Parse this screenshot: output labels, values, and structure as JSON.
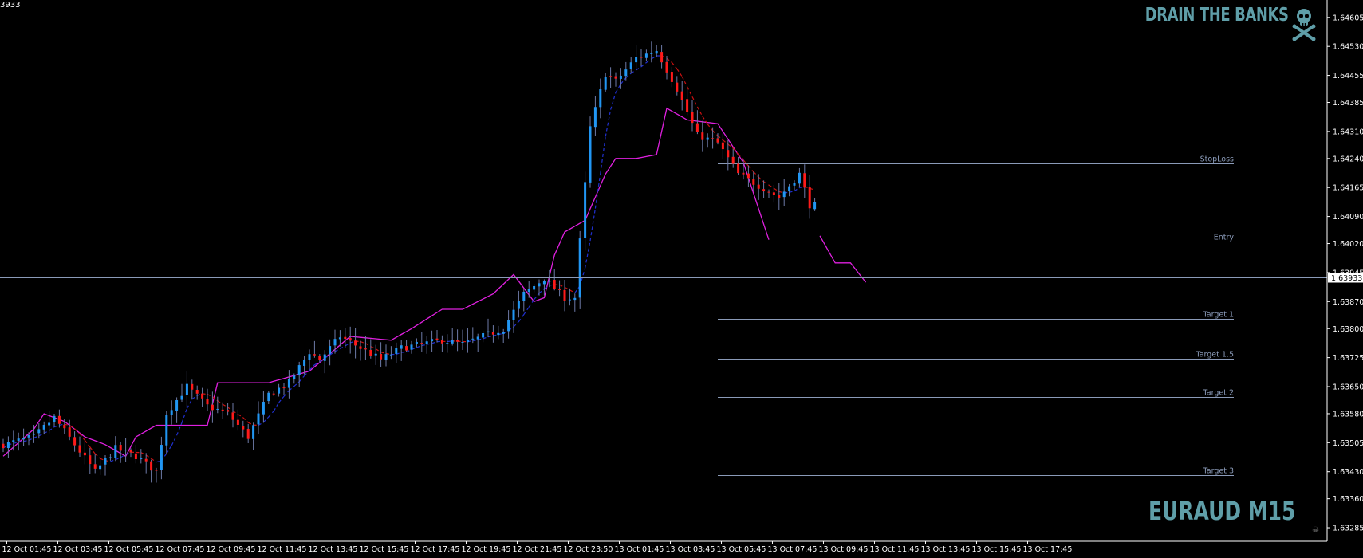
{
  "header": {
    "brand": "DRAIN THE BANKS",
    "counter": "3933",
    "mini_icon": "skull-icon"
  },
  "footer": {
    "symbol": "EURAUD M15"
  },
  "colors": {
    "background": "#000000",
    "bull": "#2196f3",
    "bear": "#ff1a1a",
    "wick": "#6e7aa8",
    "envelope": "#e020e0",
    "ma_fast": "#2030d0",
    "ma_slow": "#cc1010",
    "levels": "#8a9ab8",
    "brand": "#5f9ea8",
    "axis": "#ffffff"
  },
  "chart_data": {
    "type": "candlestick",
    "price_axis": {
      "ticks": [
        "1.64605",
        "1.64530",
        "1.64455",
        "1.64385",
        "1.64310",
        "1.64240",
        "1.64165",
        "1.64090",
        "1.64020",
        "1.63945",
        "1.63870",
        "1.63800",
        "1.63725",
        "1.63650",
        "1.63580",
        "1.63505",
        "1.63430",
        "1.63360",
        "1.63285"
      ],
      "ylim": [
        1.6325,
        1.6465
      ]
    },
    "time_axis": {
      "labels": [
        "12 Oct 01:45",
        "12 Oct 03:45",
        "12 Oct 05:45",
        "12 Oct 07:45",
        "12 Oct 09:45",
        "12 Oct 11:45",
        "12 Oct 13:45",
        "12 Oct 15:45",
        "12 Oct 17:45",
        "12 Oct 19:45",
        "12 Oct 21:45",
        "12 Oct 23:50",
        "13 Oct 01:45",
        "13 Oct 03:45",
        "13 Oct 05:45",
        "13 Oct 07:45",
        "13 Oct 09:45",
        "13 Oct 11:45",
        "13 Oct 13:45",
        "13 Oct 15:45",
        "13 Oct 17:45"
      ]
    },
    "current_price": "1.63933",
    "levels": [
      {
        "name": "StopLoss",
        "price": 1.64227
      },
      {
        "name": "Entry",
        "price": 1.64026
      },
      {
        "name": "Target 1",
        "price": 1.63825
      },
      {
        "name": "Target 1.5",
        "price": 1.63723
      },
      {
        "name": "Target 2",
        "price": 1.63624
      },
      {
        "name": "Target 3",
        "price": 1.63422
      }
    ],
    "candle_count": 160,
    "anchors": [
      [
        0,
        1.635
      ],
      [
        6,
        1.6352
      ],
      [
        10,
        1.6357
      ],
      [
        14,
        1.635
      ],
      [
        18,
        1.6343
      ],
      [
        22,
        1.6349
      ],
      [
        26,
        1.6347
      ],
      [
        30,
        1.6343
      ],
      [
        32,
        1.6358
      ],
      [
        36,
        1.6365
      ],
      [
        40,
        1.636
      ],
      [
        44,
        1.6358
      ],
      [
        48,
        1.6352
      ],
      [
        52,
        1.6363
      ],
      [
        56,
        1.6366
      ],
      [
        60,
        1.6374
      ],
      [
        62,
        1.6372
      ],
      [
        66,
        1.6378
      ],
      [
        70,
        1.6375
      ],
      [
        74,
        1.6372
      ],
      [
        78,
        1.6375
      ],
      [
        82,
        1.6376
      ],
      [
        86,
        1.6377
      ],
      [
        90,
        1.6376
      ],
      [
        94,
        1.6378
      ],
      [
        98,
        1.638
      ],
      [
        102,
        1.6389
      ],
      [
        106,
        1.6393
      ],
      [
        110,
        1.6388
      ],
      [
        112,
        1.6388
      ],
      [
        115,
        1.6432
      ],
      [
        118,
        1.6446
      ],
      [
        120,
        1.6444
      ],
      [
        124,
        1.645
      ],
      [
        128,
        1.6452
      ],
      [
        132,
        1.6442
      ],
      [
        136,
        1.643
      ],
      [
        140,
        1.6428
      ],
      [
        144,
        1.642
      ],
      [
        148,
        1.6417
      ],
      [
        152,
        1.6414
      ],
      [
        156,
        1.642
      ],
      [
        158,
        1.6412
      ]
    ],
    "envelope": [
      [
        0,
        1.6347
      ],
      [
        6,
        1.6354
      ],
      [
        8,
        1.6358
      ],
      [
        12,
        1.6356
      ],
      [
        16,
        1.6352
      ],
      [
        20,
        1.635
      ],
      [
        24,
        1.6347
      ],
      [
        26,
        1.6352
      ],
      [
        30,
        1.6355
      ],
      [
        40,
        1.6355
      ],
      [
        42,
        1.6366
      ],
      [
        48,
        1.6366
      ],
      [
        52,
        1.6366
      ],
      [
        60,
        1.6369
      ],
      [
        68,
        1.6378
      ],
      [
        76,
        1.6377
      ],
      [
        80,
        1.638
      ],
      [
        86,
        1.6385
      ],
      [
        90,
        1.6385
      ],
      [
        96,
        1.6389
      ],
      [
        100,
        1.6394
      ],
      [
        104,
        1.6387
      ],
      [
        106,
        1.6388
      ],
      [
        108,
        1.6399
      ],
      [
        110,
        1.6405
      ],
      [
        114,
        1.6408
      ],
      [
        118,
        1.642
      ],
      [
        120,
        1.6424
      ],
      [
        124,
        1.6424
      ],
      [
        128,
        1.6425
      ],
      [
        130,
        1.6437
      ],
      [
        134,
        1.6434
      ],
      [
        140,
        1.6433
      ],
      [
        145,
        1.6423
      ],
      [
        150,
        1.6403
      ]
    ]
  }
}
